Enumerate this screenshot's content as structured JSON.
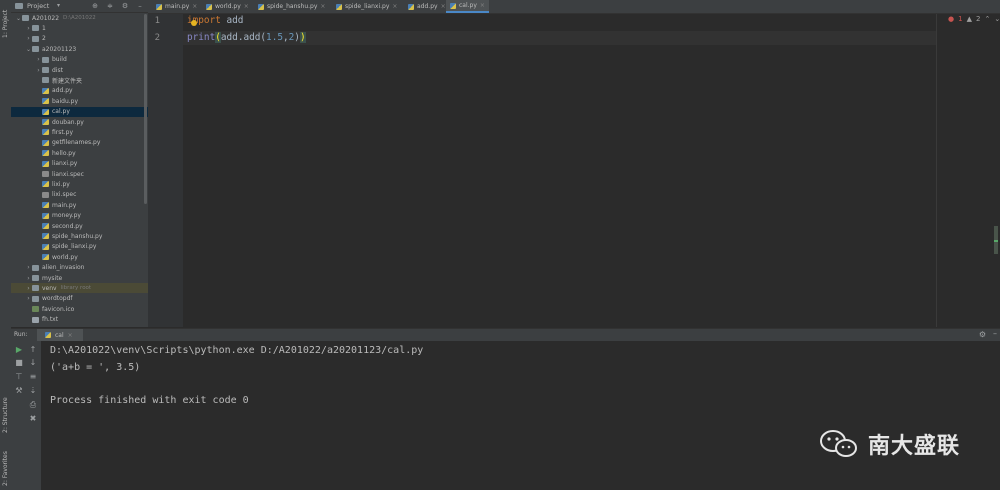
{
  "side_strip": {
    "project_label": "1: Project",
    "structure_label": "2: Structure",
    "favorites_label": "2: Favorites"
  },
  "project_panel": {
    "title": "Project",
    "tree": [
      {
        "label": "A201022",
        "sub": "D:\\A201022",
        "kind": "folder",
        "depth": 0,
        "arrow": "down"
      },
      {
        "label": "1",
        "kind": "folder",
        "depth": 1,
        "arrow": "right"
      },
      {
        "label": "2",
        "kind": "folder",
        "depth": 1,
        "arrow": "right"
      },
      {
        "label": "a20201123",
        "kind": "folder",
        "depth": 1,
        "arrow": "down"
      },
      {
        "label": "build",
        "kind": "folder",
        "depth": 2,
        "arrow": "right"
      },
      {
        "label": "dist",
        "kind": "folder",
        "depth": 2,
        "arrow": "right"
      },
      {
        "label": "新建文件夹",
        "kind": "folder",
        "depth": 2,
        "arrow": ""
      },
      {
        "label": "add.py",
        "kind": "py",
        "depth": 2,
        "arrow": ""
      },
      {
        "label": "baidu.py",
        "kind": "py",
        "depth": 2,
        "arrow": ""
      },
      {
        "label": "cal.py",
        "kind": "py",
        "depth": 2,
        "arrow": "",
        "selected": true
      },
      {
        "label": "douban.py",
        "kind": "py",
        "depth": 2,
        "arrow": ""
      },
      {
        "label": "first.py",
        "kind": "py",
        "depth": 2,
        "arrow": ""
      },
      {
        "label": "getfilenames.py",
        "kind": "py",
        "depth": 2,
        "arrow": ""
      },
      {
        "label": "hello.py",
        "kind": "py",
        "depth": 2,
        "arrow": ""
      },
      {
        "label": "lianxi.py",
        "kind": "py",
        "depth": 2,
        "arrow": ""
      },
      {
        "label": "lianxi.spec",
        "kind": "spec",
        "depth": 2,
        "arrow": ""
      },
      {
        "label": "lixi.py",
        "kind": "py",
        "depth": 2,
        "arrow": ""
      },
      {
        "label": "lixi.spec",
        "kind": "spec",
        "depth": 2,
        "arrow": ""
      },
      {
        "label": "main.py",
        "kind": "py",
        "depth": 2,
        "arrow": ""
      },
      {
        "label": "money.py",
        "kind": "py",
        "depth": 2,
        "arrow": ""
      },
      {
        "label": "second.py",
        "kind": "py",
        "depth": 2,
        "arrow": ""
      },
      {
        "label": "spide_hanshu.py",
        "kind": "py",
        "depth": 2,
        "arrow": ""
      },
      {
        "label": "spide_lianxi.py",
        "kind": "py",
        "depth": 2,
        "arrow": ""
      },
      {
        "label": "world.py",
        "kind": "py",
        "depth": 2,
        "arrow": ""
      },
      {
        "label": "alien_invasion",
        "kind": "folder",
        "depth": 1,
        "arrow": "right"
      },
      {
        "label": "mysite",
        "kind": "folder",
        "depth": 1,
        "arrow": "right"
      },
      {
        "label": "venv",
        "sub": "library root",
        "kind": "folder",
        "depth": 1,
        "arrow": "right",
        "venv": true
      },
      {
        "label": "wordtopdf",
        "kind": "folder",
        "depth": 1,
        "arrow": "right"
      },
      {
        "label": "favicon.ico",
        "kind": "ico",
        "depth": 1,
        "arrow": ""
      },
      {
        "label": "fh.txt",
        "kind": "txt",
        "depth": 1,
        "arrow": ""
      }
    ]
  },
  "tabs": [
    {
      "label": "main.py",
      "active": false
    },
    {
      "label": "world.py",
      "active": false
    },
    {
      "label": "spide_hanshu.py",
      "active": false
    },
    {
      "label": "spide_lianxi.py",
      "active": false
    },
    {
      "label": "add.py",
      "active": false
    },
    {
      "label": "cal.py",
      "active": true
    }
  ],
  "editor": {
    "line_numbers": [
      "1",
      "2"
    ],
    "line1": {
      "kw": "import",
      "rest": " add"
    },
    "line2": {
      "fn": "print",
      "open": "(",
      "mid": "add.add(",
      "n1": "1.5",
      "comma": ",",
      "n2": "2",
      "close_inner": ")",
      "close": ")"
    },
    "errors": "1",
    "warnings": "2"
  },
  "run": {
    "label": "Run:",
    "tab": "cal",
    "console": [
      "D:\\A201022\\venv\\Scripts\\python.exe D:/A201022/a20201123/cal.py",
      "('a+b = ', 3.5)",
      "",
      "Process finished with exit code 0"
    ]
  },
  "watermark": {
    "text": "南大盛联"
  },
  "colors": {
    "accent": "#4a88c7",
    "background": "#2b2b2b",
    "panel": "#3c3f41",
    "keyword": "#cc7832"
  }
}
